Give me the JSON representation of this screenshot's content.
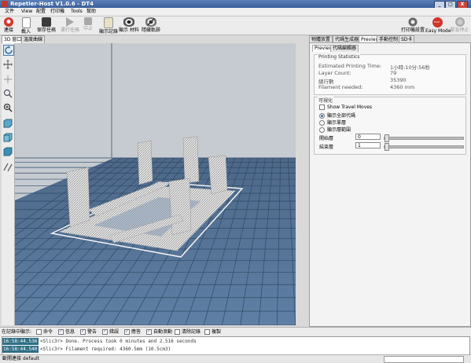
{
  "window": {
    "title": "Repetier-Host V1.0.6 - DT4",
    "buttons": [
      "_",
      "□",
      "X"
    ]
  },
  "menu": [
    "文件",
    "View",
    "配置",
    "打印機",
    "Tools",
    "幫助"
  ],
  "toolbar": {
    "connect": "連接",
    "load": "載入",
    "save_job": "保存任務",
    "run_job": "運行任務",
    "stop": "中止",
    "show_log": "顯示記錄",
    "show_filament": "顯示 材料",
    "hide_travel": "隱藏軌跡",
    "printer_settings": "打印機設置",
    "easy_mode": "Easy Mode",
    "emergency_stop": "緊急停止",
    "easy_badge": "EASY"
  },
  "left_tabs": [
    "3D 窗口",
    "溫度曲線"
  ],
  "right_tabs": [
    "物體放置",
    "代碼生成器",
    "Preview",
    "手動控制",
    "SD卡"
  ],
  "subtabs": [
    "Preview",
    "代碼編輯器"
  ],
  "statistics": {
    "title": "Printing Statistics",
    "rows": [
      {
        "label": "Estimated Printing Time:",
        "value": "1小時:10分:56秒"
      },
      {
        "label": "Layer Count:",
        "value": "79"
      },
      {
        "label": "總行數",
        "value": "35390"
      },
      {
        "label": "Filament needed:",
        "value": "4360 mm"
      }
    ]
  },
  "visualization": {
    "title": "可視化",
    "show_travel": "Show Travel Moves",
    "options": [
      "顯示全部代碼",
      "顯示單層",
      "顯示層範圍"
    ],
    "selected_option": 0,
    "first_layer_label": "開始層",
    "first_layer_value": "0",
    "last_layer_label": "結束層",
    "last_layer_value": "1"
  },
  "log": {
    "filter_label": "在記錄中顯示:",
    "filters": [
      {
        "label": "命令",
        "checked": false
      },
      {
        "label": "信息",
        "checked": true
      },
      {
        "label": "警告",
        "checked": true
      },
      {
        "label": "錯誤",
        "checked": true
      },
      {
        "label": "應答",
        "checked": true
      },
      {
        "label": "自動滾動",
        "checked": true
      },
      {
        "label": "清除記錄",
        "checked": false
      },
      {
        "label": "複製",
        "checked": false
      }
    ],
    "lines": [
      {
        "time": "16:58:44.536",
        "message": "<Slic3r> Done. Process took 0 minutes and 2.516 seconds"
      },
      {
        "time": "16:58:44.540",
        "message": "<Slic3r> Filament required: 4360.5mm (10.5cm3)"
      }
    ]
  },
  "statusbar": {
    "text": "斷開連接 default"
  },
  "colors": {
    "title_bar": "#3a5f9a",
    "easy_badge": "#d0352f",
    "floor_grid": "#2f4a66"
  }
}
